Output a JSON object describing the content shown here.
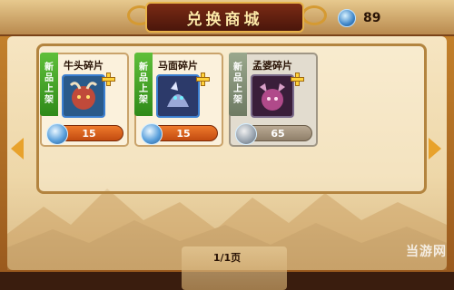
{
  "header": {
    "title": "兑换商城"
  },
  "currency": {
    "icon": "gem-icon",
    "amount": "89"
  },
  "items": [
    {
      "name": "牛头碎片",
      "badge": [
        "新",
        "品",
        "上",
        "架"
      ],
      "price": "15",
      "affordable": true,
      "portrait_color": "#2a5a8a",
      "face_color": "#c04a3a"
    },
    {
      "name": "马面碎片",
      "badge": [
        "新",
        "品",
        "上",
        "架"
      ],
      "price": "15",
      "affordable": true,
      "portrait_color": "#2c3a6a",
      "face_color": "#9aa8d8"
    },
    {
      "name": "孟婆碎片",
      "badge": [
        "新",
        "品",
        "上",
        "架"
      ],
      "price": "65",
      "affordable": false,
      "portrait_color": "#3a1e3a",
      "face_color": "#b04a8a"
    }
  ],
  "pagination": {
    "label": "1/1页"
  },
  "nav": {
    "prev_icon": "arrow-left-icon",
    "next_icon": "arrow-right-icon"
  },
  "watermark": {
    "text": "当游网"
  }
}
